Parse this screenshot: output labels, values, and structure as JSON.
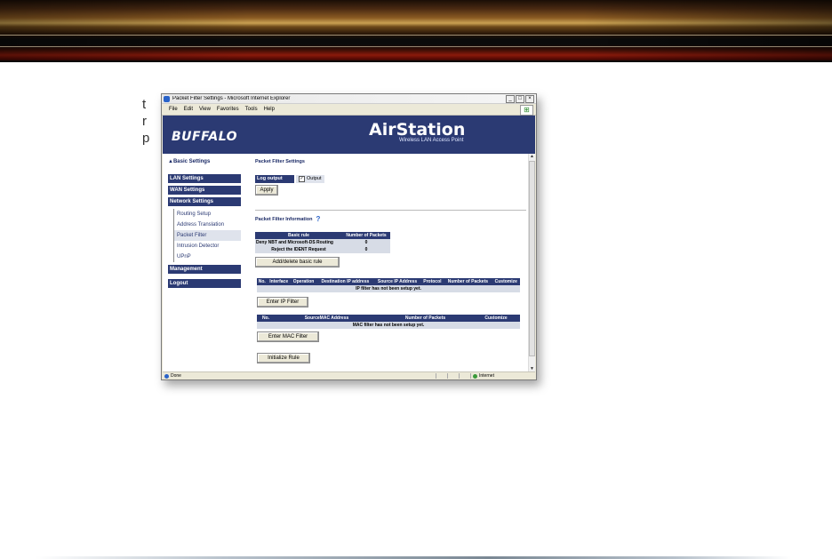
{
  "browser": {
    "title": "Packet Filter Settings - Microsoft Internet Explorer",
    "menu": [
      "File",
      "Edit",
      "View",
      "Favorites",
      "Tools",
      "Help"
    ],
    "status": {
      "text": "Done",
      "zone": "Internet"
    }
  },
  "page": {
    "logo_left": "BUFFALO",
    "logo_right": "AirStation",
    "logo_subtitle": "Wireless LAN Access Point",
    "background_text": "t\nr\np",
    "sidebar": {
      "basic_link": "▲Basic Settings",
      "items": [
        "LAN Settings",
        "WAN Settings",
        "Network Settings"
      ],
      "subitems": [
        "Routing Setup",
        "Address Translation",
        "Packet Filter",
        "Intrusion Detector",
        "UPnP"
      ],
      "management": "Management",
      "logout": "Logout"
    },
    "main": {
      "settings_title": "Packet Filter Settings",
      "log_output_label": "Log output",
      "log_output_check": "Output",
      "apply": "Apply",
      "info_title": "Packet Filter Information",
      "help_icon": "?",
      "basic_table": {
        "headers": [
          "Basic rule",
          "Number of Packets"
        ],
        "rows": [
          [
            "Deny NBT and Microsoft-DS Routing",
            "0"
          ],
          [
            "Reject the IDENT Request",
            "0"
          ]
        ]
      },
      "add_delete_button": "Add/delete basic rule",
      "ip_table": {
        "headers": [
          "No.",
          "Interface",
          "Operation",
          "Destination IP address",
          "Source IP Address",
          "Protocol",
          "Number of Packets",
          "Customize"
        ],
        "message": "IP filter has not been setup yet."
      },
      "enter_ip_button": "Enter IP Filter",
      "mac_table": {
        "headers": [
          "No.",
          "SourceMAC Address",
          "Number of Packets",
          "Customize"
        ],
        "message": "MAC filter has not been setup yet."
      },
      "enter_mac_button": "Enter MAC Filter",
      "initialize_button": "Initialize Rule"
    }
  },
  "colors": {
    "nav": "#2b3a73",
    "cell": "#d7dce6",
    "link": "#1b2a66"
  }
}
